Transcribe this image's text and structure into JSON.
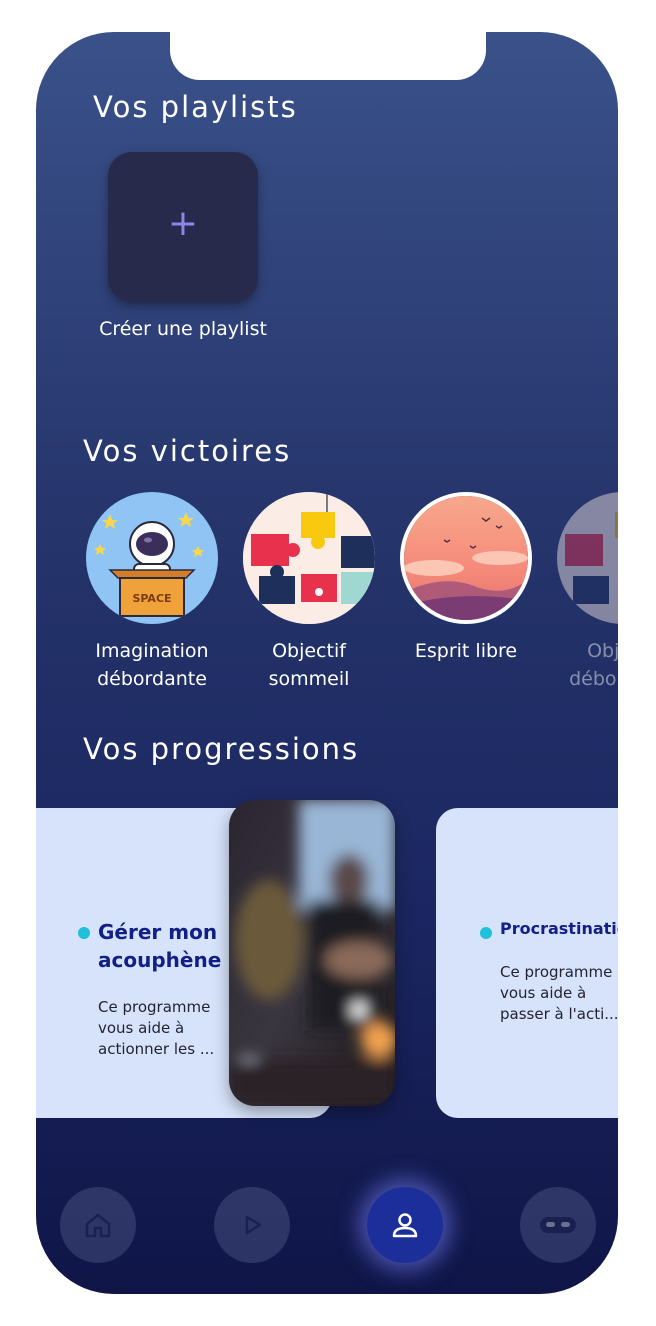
{
  "playlists": {
    "title": "Vos playlists",
    "create_symbol": "+",
    "create_label": "Créer une playlist"
  },
  "victories": {
    "title": "Vos victoires",
    "badges": [
      {
        "label_line1": "Imagination",
        "label_line2": "débordante",
        "space_text": "SPACE"
      },
      {
        "label_line1": "Objectif",
        "label_line2": "sommeil"
      },
      {
        "label_line1": "Esprit libre",
        "label_line2": ""
      },
      {
        "label_line1": "Objectif",
        "label_line2": "débordante"
      }
    ]
  },
  "progressions": {
    "title": "Vos progressions",
    "cards": [
      {
        "title_line1": "Gérer mon",
        "title_line2": "acouphène",
        "desc_line1": "Ce programme",
        "desc_line2": "vous aide à",
        "desc_line3": "actionner les ..."
      },
      {
        "title_line1": "Procrastination",
        "title_line2": "",
        "desc_line1": "Ce programme",
        "desc_line2": "vous aide à",
        "desc_line3": "passer à l'acti..."
      }
    ]
  },
  "nav": {
    "items": [
      "home-icon",
      "play-icon",
      "profile-icon",
      "vr-headset-icon"
    ],
    "active": "profile-icon"
  },
  "colors": {
    "accent_plus": "#8b86ee",
    "card_bg": "#d7e3fa",
    "card_title": "#111f86",
    "dot": "#1ec0dc",
    "nav_active": "#1c2e9a"
  }
}
